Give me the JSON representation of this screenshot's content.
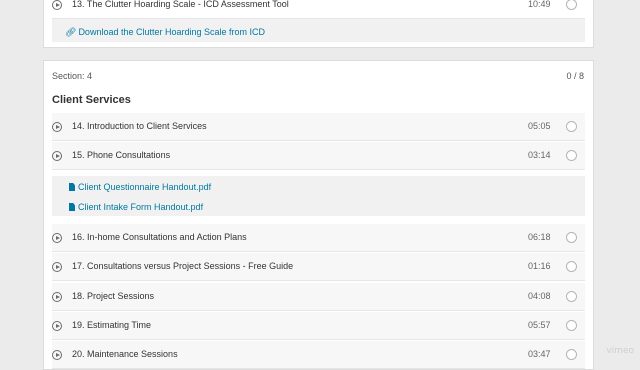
{
  "prev_section": {
    "lecture": {
      "title": "13. The Clutter Hoarding Scale - ICD Assessment Tool",
      "duration": "10:49"
    },
    "resource": "Download the Clutter Hoarding Scale from ICD"
  },
  "section": {
    "label": "Section: 4",
    "count": "0 / 8",
    "title": "Client Services",
    "lectures": [
      {
        "title": "14. Introduction to Client Services",
        "duration": "05:05"
      },
      {
        "title": "15. Phone Consultations",
        "duration": "03:14"
      },
      {
        "title": "16. In-home Consultations and Action Plans",
        "duration": "06:18"
      },
      {
        "title": "17. Consultations versus Project Sessions - Free Guide",
        "duration": "01:16"
      },
      {
        "title": "18. Project Sessions",
        "duration": "04:08"
      },
      {
        "title": "19. Estimating Time",
        "duration": "05:57"
      },
      {
        "title": "20. Maintenance Sessions",
        "duration": "03:47"
      }
    ],
    "resources": [
      "Client Questionnaire Handout.pdf",
      "Client Intake Form Handout.pdf"
    ]
  },
  "watermark": "vimeo",
  "colors": {
    "link": "#00789f",
    "background": "#ebebeb"
  }
}
